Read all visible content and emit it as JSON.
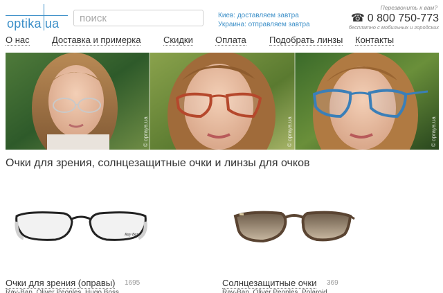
{
  "header": {
    "logo_text": "optika",
    "logo_suffix": "ua",
    "search_placeholder": "поиск",
    "delivery": [
      "Киев: доставляем завтра",
      "Украина: отправляем завтра"
    ],
    "callback": "Перезвонить к вам?",
    "phone": "0 800 750-773",
    "phone_note": "бесплатно с мобильных и городских"
  },
  "nav": {
    "items": [
      "О нас",
      "Доставка и примерка",
      "Скидки",
      "Оплата",
      "Подобрать линзы",
      "Контакты"
    ]
  },
  "banner": {
    "watermark": "© opraya.ua",
    "frames": [
      "silver-rimless",
      "red-cat-eye",
      "blue-frame"
    ]
  },
  "main": {
    "title": "Очки для зрения, солнцезащитные очки и линзы для очков",
    "categories": [
      {
        "label": "Очки для зрения (оправы)",
        "count": "1695",
        "sub": "Ray-Ban, Oliver Peoples, Hugo Boss..."
      },
      {
        "label": "Солнцезащитные очки",
        "count": "369",
        "sub": "Ray-Ban, Oliver Peoples, Polaroid..."
      }
    ]
  },
  "colors": {
    "accent": "#3c8fc8",
    "text": "#333333"
  }
}
